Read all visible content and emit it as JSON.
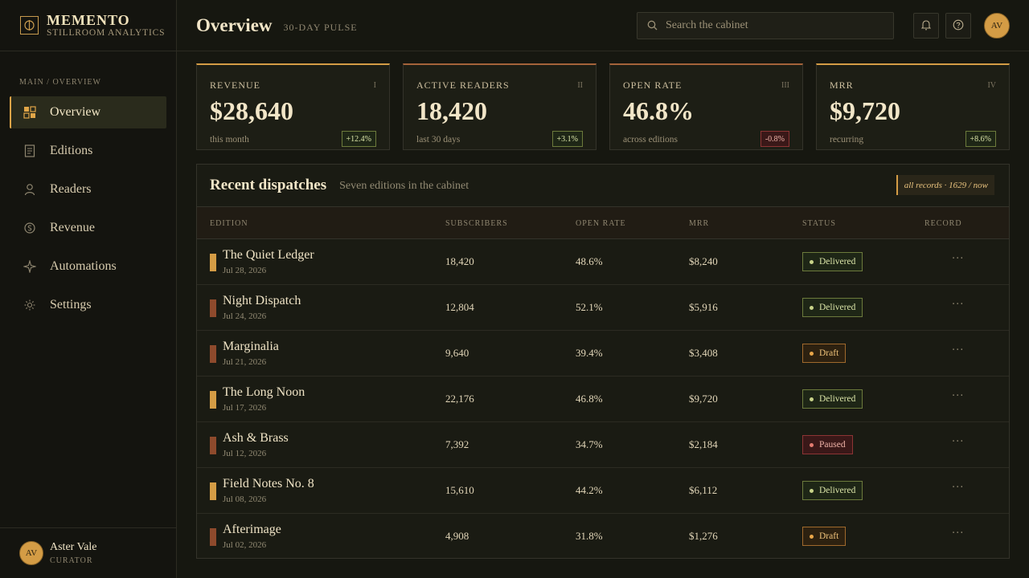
{
  "brand": {
    "name": "MEMENTO",
    "subtitle": "STILLROOM ANALYTICS"
  },
  "sidebar": {
    "section": "MAIN / OVERVIEW",
    "items": [
      {
        "label": "Overview",
        "icon": "grid-icon",
        "active": true
      },
      {
        "label": "Editions",
        "icon": "document-icon"
      },
      {
        "label": "Readers",
        "icon": "user-icon"
      },
      {
        "label": "Revenue",
        "icon": "coin-icon"
      },
      {
        "label": "Automations",
        "icon": "sparkle-icon"
      },
      {
        "label": "Settings",
        "icon": "gear-icon"
      }
    ],
    "user": {
      "initials": "AV",
      "name": "Aster Vale",
      "role": "CURATOR"
    }
  },
  "header": {
    "title": "Overview",
    "subtitle": "30-DAY PULSE",
    "search_placeholder": "Search the cabinet",
    "avatar_initials": "AV"
  },
  "kpis": [
    {
      "label": "REVENUE",
      "roman": "I",
      "value": "$28,640",
      "foot": "this month",
      "delta": "+12.4%",
      "trend": "up"
    },
    {
      "label": "ACTIVE READERS",
      "roman": "II",
      "value": "18,420",
      "foot": "last 30 days",
      "delta": "+3.1%",
      "trend": "up"
    },
    {
      "label": "OPEN RATE",
      "roman": "III",
      "value": "46.8%",
      "foot": "across editions",
      "delta": "-0.8%",
      "trend": "down"
    },
    {
      "label": "MRR",
      "roman": "IV",
      "value": "$9,720",
      "foot": "recurring",
      "delta": "+8.6%",
      "trend": "up"
    }
  ],
  "table": {
    "title": "Recent dispatches",
    "subtitle": "Seven editions in the cabinet",
    "tag": "all records · 1629 / now",
    "columns": [
      "EDITION",
      "SUBSCRIBERS",
      "OPEN RATE",
      "MRR",
      "STATUS",
      "RECORD"
    ],
    "rows": [
      {
        "title": "The Quiet Ledger",
        "date": "Jul 28, 2026",
        "subscribers": "18,420",
        "open_rate": "48.6%",
        "mrr": "$8,240",
        "status": "Delivered",
        "accent": "gold"
      },
      {
        "title": "Night Dispatch",
        "date": "Jul 24, 2026",
        "subscribers": "12,804",
        "open_rate": "52.1%",
        "mrr": "$5,916",
        "status": "Delivered",
        "accent": "copper"
      },
      {
        "title": "Marginalia",
        "date": "Jul 21, 2026",
        "subscribers": "9,640",
        "open_rate": "39.4%",
        "mrr": "$3,408",
        "status": "Draft",
        "accent": "copper"
      },
      {
        "title": "The Long Noon",
        "date": "Jul 17, 2026",
        "subscribers": "22,176",
        "open_rate": "46.8%",
        "mrr": "$9,720",
        "status": "Delivered",
        "accent": "gold"
      },
      {
        "title": "Ash & Brass",
        "date": "Jul 12, 2026",
        "subscribers": "7,392",
        "open_rate": "34.7%",
        "mrr": "$2,184",
        "status": "Paused",
        "accent": "copper"
      },
      {
        "title": "Field Notes No. 8",
        "date": "Jul 08, 2026",
        "subscribers": "15,610",
        "open_rate": "44.2%",
        "mrr": "$6,112",
        "status": "Delivered",
        "accent": "gold"
      },
      {
        "title": "Afterimage",
        "date": "Jul 02, 2026",
        "subscribers": "4,908",
        "open_rate": "31.8%",
        "mrr": "$1,276",
        "status": "Draft",
        "accent": "copper"
      }
    ],
    "more_label": "···"
  },
  "colors": {
    "gold": "#d49c45",
    "copper": "#8e4a2c",
    "background": "#161710"
  }
}
